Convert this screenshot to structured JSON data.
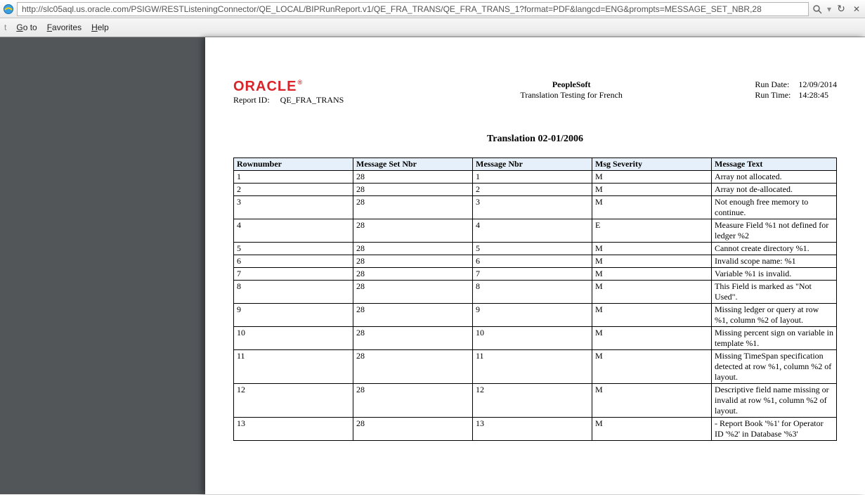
{
  "browser": {
    "url": "http://slc05aql.us.oracle.com/PSIGW/RESTListeningConnector/QE_LOCAL/BIPRunReport.v1/QE_FRA_TRANS/QE_FRA_TRANS_1?format=PDF&langcd=ENG&prompts=MESSAGE_SET_NBR,28",
    "search_hint": "•",
    "refresh": "↻",
    "stop": "✕"
  },
  "menu": {
    "goto": "Go to",
    "favorites": "Favorites",
    "help": "Help"
  },
  "report": {
    "logo_text": "ORACLE",
    "logo_reg": "®",
    "report_id_label": "Report ID:",
    "report_id_value": "QE_FRA_TRANS",
    "center_line1": "PeopleSoft",
    "center_line2": "Translation Testing for French",
    "run_date_label": "Run Date:",
    "run_date_value": "12/09/2014",
    "run_time_label": "Run Time:",
    "run_time_value": "14:28:45",
    "section_title": "Translation 02-01/2006"
  },
  "columns": {
    "c1": "Rownumber",
    "c2": "Message Set Nbr",
    "c3": "Message Nbr",
    "c4": "Msg Severity",
    "c5": "Message Text"
  },
  "rows": [
    {
      "n": "1",
      "set": "28",
      "nbr": "1",
      "sev": "M",
      "text": "Array not allocated."
    },
    {
      "n": "2",
      "set": "28",
      "nbr": "2",
      "sev": "M",
      "text": "Array not de-allocated."
    },
    {
      "n": "3",
      "set": "28",
      "nbr": "3",
      "sev": "M",
      "text": "Not enough free memory to continue."
    },
    {
      "n": "4",
      "set": "28",
      "nbr": "4",
      "sev": "E",
      "text": "Measure Field %1 not defined for ledger %2"
    },
    {
      "n": "5",
      "set": "28",
      "nbr": "5",
      "sev": "M",
      "text": "Cannot create directory %1."
    },
    {
      "n": "6",
      "set": "28",
      "nbr": "6",
      "sev": "M",
      "text": "Invalid scope name:  %1"
    },
    {
      "n": "7",
      "set": "28",
      "nbr": "7",
      "sev": "M",
      "text": "Variable %1 is invalid."
    },
    {
      "n": "8",
      "set": "28",
      "nbr": "8",
      "sev": "M",
      "text": "This Field is marked as \"Not Used\"."
    },
    {
      "n": "9",
      "set": "28",
      "nbr": "9",
      "sev": "M",
      "text": "Missing ledger or query at row %1, column %2 of layout."
    },
    {
      "n": "10",
      "set": "28",
      "nbr": "10",
      "sev": "M",
      "text": "Missing percent sign on variable in template %1."
    },
    {
      "n": "11",
      "set": "28",
      "nbr": "11",
      "sev": "M",
      "text": "Missing TimeSpan specification detected at row %1, column %2 of layout."
    },
    {
      "n": "12",
      "set": "28",
      "nbr": "12",
      "sev": "M",
      "text": "Descriptive field name missing or invalid at row %1, column %2 of layout."
    },
    {
      "n": "13",
      "set": "28",
      "nbr": "13",
      "sev": "M",
      "text": "- Report Book '%1' for Operator ID '%2' in Database '%3'"
    }
  ]
}
